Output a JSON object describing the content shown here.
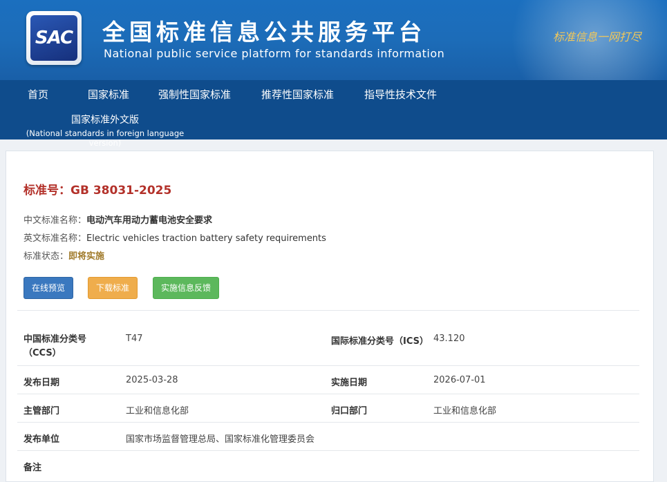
{
  "header": {
    "logo_text": "SAC",
    "title": "全国标准信息公共服务平台",
    "subtitle": "National public service platform  for standards information",
    "slogan": "标准信息一网打尽"
  },
  "nav": {
    "items": [
      "首页",
      "国家标准",
      "强制性国家标准",
      "推荐性国家标准",
      "指导性技术文件"
    ],
    "foreign_cn": "国家标准外文版",
    "foreign_en": "(National standards in foreign language version)"
  },
  "standard": {
    "number_label": "标准号：",
    "number": "GB 38031-2025",
    "cn_name_label": "中文标准名称：",
    "cn_name": "电动汽车用动力蓄电池安全要求",
    "en_name_label": "英文标准名称：",
    "en_name": "Electric vehicles traction battery safety requirements",
    "status_label": "标准状态：",
    "status": "即将实施"
  },
  "buttons": {
    "preview": "在线预览",
    "download": "下载标准",
    "feedback": "实施信息反馈"
  },
  "details": {
    "ccs_label_1": "中国标准分类号",
    "ccs_label_2": "（CCS）",
    "ccs": "T47",
    "ics_label": "国际标准分类号（ICS）",
    "ics": "43.120",
    "pub_date_label": "发布日期",
    "pub_date": "2025-03-28",
    "impl_date_label": "实施日期",
    "impl_date": "2026-07-01",
    "dept_label": "主管部门",
    "dept": "工业和信息化部",
    "owner_label": "归口部门",
    "owner": "工业和信息化部",
    "publisher_label": "发布单位",
    "publisher": "国家市场监督管理总局、国家标准化管理委员会",
    "remark_label": "备注"
  },
  "colors": {
    "header_blue": "#1b6fbf",
    "nav_blue": "#0f4c8c",
    "title_red": "#b3312a",
    "status_gold": "#a07a2a"
  }
}
